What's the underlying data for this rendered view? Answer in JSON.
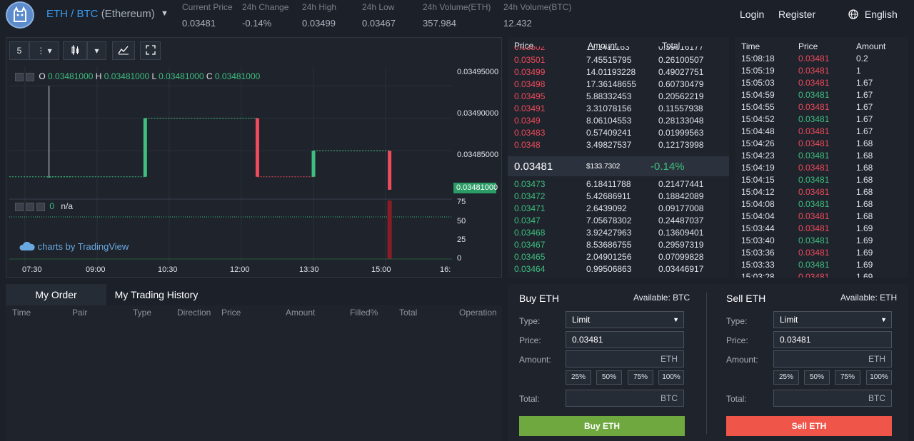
{
  "header": {
    "pair_main": "ETH / BTC",
    "pair_sub": "(Ethereum)",
    "stats": [
      {
        "label": "Current Price",
        "value": "0.03481",
        "color": "#ef4b5a"
      },
      {
        "label": "24h Change",
        "value": "-0.14%",
        "color": "#ef4b5a"
      },
      {
        "label": "24h High",
        "value": "0.03499",
        "color": "#a9b0bb"
      },
      {
        "label": "24h Low",
        "value": "0.03467",
        "color": "#a9b0bb"
      },
      {
        "label": "24h Volume(ETH)",
        "value": "357.984",
        "color": "#a9b0bb"
      },
      {
        "label": "24h Volume(BTC)",
        "value": "12.432",
        "color": "#a9b0bb"
      }
    ],
    "login": "Login",
    "register": "Register",
    "language": "English"
  },
  "chart": {
    "interval": "5",
    "ohlc": {
      "o_label": "O",
      "o": "0.03481000",
      "h_label": "H",
      "h": "0.03481000",
      "l_label": "L",
      "l": "0.03481000",
      "c_label": "C",
      "c": "0.03481000"
    },
    "price_axis": [
      "0.03495000",
      "0.03490000",
      "0.03485000"
    ],
    "current_price_badge": "0.03481000",
    "volume_axis": [
      "75",
      "50",
      "25",
      "0"
    ],
    "indicator_value": "0",
    "indicator_label": "n/a",
    "time_axis": [
      "07:30",
      "09:00",
      "10:30",
      "12:00",
      "13:30",
      "15:00",
      "16:"
    ],
    "brand": "charts by TradingView"
  },
  "chart_data": {
    "type": "candlestick",
    "ylim": [
      0.03478,
      0.03498
    ],
    "candles": [
      {
        "x": "08:00",
        "o": 0.03481,
        "h": 0.03495,
        "l": 0.03481,
        "c": 0.03481
      },
      {
        "x": "10:00",
        "o": 0.03481,
        "h": 0.0349,
        "l": 0.03481,
        "c": 0.0349
      },
      {
        "x": "12:20",
        "o": 0.0349,
        "h": 0.0349,
        "l": 0.03481,
        "c": 0.03481
      },
      {
        "x": "13:30",
        "o": 0.03481,
        "h": 0.03485,
        "l": 0.03481,
        "c": 0.03485
      },
      {
        "x": "15:05",
        "o": 0.03485,
        "h": 0.03485,
        "l": 0.03479,
        "c": 0.03479
      }
    ],
    "volume_ylim": [
      0,
      80
    ],
    "volume": [
      {
        "x": "15:05",
        "v": 80
      }
    ]
  },
  "book": {
    "headers": [
      "Price",
      "Amount",
      "Total"
    ],
    "asks": [
      {
        "price": "0.03502",
        "amount": "11.1411163",
        "total": "0.39016177"
      },
      {
        "price": "0.03501",
        "amount": "7.45515795",
        "total": "0.26100507"
      },
      {
        "price": "0.03499",
        "amount": "14.01193228",
        "total": "0.49027751"
      },
      {
        "price": "0.03498",
        "amount": "17.36148655",
        "total": "0.60730479"
      },
      {
        "price": "0.03495",
        "amount": "5.88332453",
        "total": "0.20562219"
      },
      {
        "price": "0.03491",
        "amount": "3.31078156",
        "total": "0.11557938"
      },
      {
        "price": "0.0349",
        "amount": "8.06104553",
        "total": "0.28133048"
      },
      {
        "price": "0.03483",
        "amount": "0.57409241",
        "total": "0.01999563"
      },
      {
        "price": "0.0348",
        "amount": "3.49827537",
        "total": "0.12173998"
      }
    ],
    "mid": {
      "price": "0.03481",
      "usd": "$133.7302",
      "change": "-0.14%"
    },
    "bids": [
      {
        "price": "0.03473",
        "amount": "6.18411788",
        "total": "0.21477441"
      },
      {
        "price": "0.03472",
        "amount": "5.42686911",
        "total": "0.18842089"
      },
      {
        "price": "0.03471",
        "amount": "2.6439092",
        "total": "0.09177008"
      },
      {
        "price": "0.0347",
        "amount": "7.05678302",
        "total": "0.24487037"
      },
      {
        "price": "0.03468",
        "amount": "3.92427963",
        "total": "0.13609401"
      },
      {
        "price": "0.03467",
        "amount": "8.53686755",
        "total": "0.29597319"
      },
      {
        "price": "0.03465",
        "amount": "2.04901256",
        "total": "0.07099828"
      },
      {
        "price": "0.03464",
        "amount": "0.99506863",
        "total": "0.03446917"
      },
      {
        "price": "0.03463",
        "amount": "4.13625583",
        "total": "0.1432388"
      }
    ]
  },
  "trades": {
    "headers": [
      "Time",
      "Price",
      "Amount"
    ],
    "rows": [
      {
        "time": "15:08:18",
        "price": "0.03481",
        "amount": "0.2",
        "side": "sell"
      },
      {
        "time": "15:05:19",
        "price": "0.03481",
        "amount": "1",
        "side": "sell"
      },
      {
        "time": "15:05:03",
        "price": "0.03481",
        "amount": "1.67",
        "side": "sell"
      },
      {
        "time": "15:04:59",
        "price": "0.03481",
        "amount": "1.67",
        "side": "buy"
      },
      {
        "time": "15:04:55",
        "price": "0.03481",
        "amount": "1.67",
        "side": "sell"
      },
      {
        "time": "15:04:52",
        "price": "0.03481",
        "amount": "1.67",
        "side": "buy"
      },
      {
        "time": "15:04:48",
        "price": "0.03481",
        "amount": "1.67",
        "side": "sell"
      },
      {
        "time": "15:04:26",
        "price": "0.03481",
        "amount": "1.68",
        "side": "sell"
      },
      {
        "time": "15:04:23",
        "price": "0.03481",
        "amount": "1.68",
        "side": "buy"
      },
      {
        "time": "15:04:19",
        "price": "0.03481",
        "amount": "1.68",
        "side": "sell"
      },
      {
        "time": "15:04:15",
        "price": "0.03481",
        "amount": "1.68",
        "side": "buy"
      },
      {
        "time": "15:04:12",
        "price": "0.03481",
        "amount": "1.68",
        "side": "sell"
      },
      {
        "time": "15:04:08",
        "price": "0.03481",
        "amount": "1.68",
        "side": "buy"
      },
      {
        "time": "15:04:04",
        "price": "0.03481",
        "amount": "1.68",
        "side": "sell"
      },
      {
        "time": "15:03:44",
        "price": "0.03481",
        "amount": "1.69",
        "side": "sell"
      },
      {
        "time": "15:03:40",
        "price": "0.03481",
        "amount": "1.69",
        "side": "buy"
      },
      {
        "time": "15:03:36",
        "price": "0.03481",
        "amount": "1.69",
        "side": "sell"
      },
      {
        "time": "15:03:33",
        "price": "0.03481",
        "amount": "1.69",
        "side": "buy"
      },
      {
        "time": "15:03:28",
        "price": "0.03481",
        "amount": "1.69",
        "side": "sell"
      }
    ]
  },
  "orders": {
    "tabs": [
      "My Order",
      "My Trading History"
    ],
    "columns": [
      "Time",
      "Pair",
      "Type",
      "Direction",
      "Price",
      "Amount",
      "Filled%",
      "Total",
      "Operation"
    ]
  },
  "buy": {
    "title": "Buy ETH",
    "available": "Available: BTC",
    "type_label": "Type:",
    "type_value": "Limit",
    "price_label": "Price:",
    "price_value": "0.03481",
    "amount_label": "Amount:",
    "amount_unit": "ETH",
    "pcts": [
      "25%",
      "50%",
      "75%",
      "100%"
    ],
    "total_label": "Total:",
    "total_unit": "BTC",
    "button": "Buy ETH",
    "color": "#6ea83f"
  },
  "sell": {
    "title": "Sell ETH",
    "available": "Available: ETH",
    "type_label": "Type:",
    "type_value": "Limit",
    "price_label": "Price:",
    "price_value": "0.03481",
    "amount_label": "Amount:",
    "amount_unit": "ETH",
    "pcts": [
      "25%",
      "50%",
      "75%",
      "100%"
    ],
    "total_label": "Total:",
    "total_unit": "BTC",
    "button": "Sell ETH",
    "color": "#f0554a"
  }
}
